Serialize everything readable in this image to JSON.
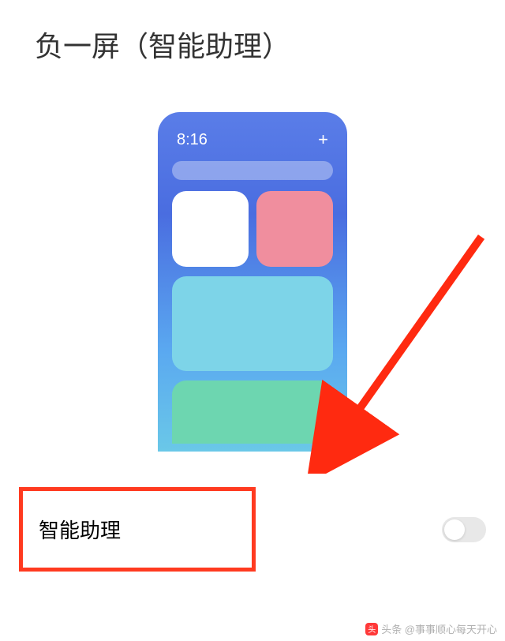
{
  "page": {
    "title": "负一屏（智能助理）"
  },
  "preview": {
    "time": "8:16",
    "plus": "+"
  },
  "setting": {
    "label": "智能助理",
    "enabled": false
  },
  "watermark": {
    "icon_text": "头",
    "text": "头条 @事事顺心每天开心"
  }
}
